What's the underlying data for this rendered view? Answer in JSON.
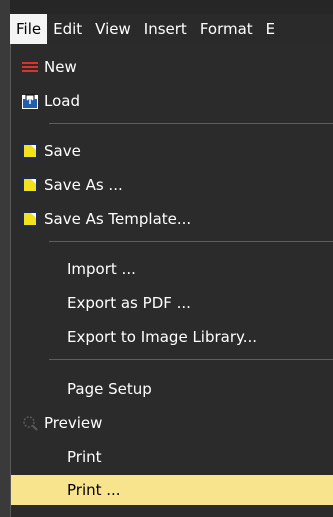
{
  "menubar": {
    "items": [
      {
        "label": "File",
        "active": true
      },
      {
        "label": "Edit"
      },
      {
        "label": "View"
      },
      {
        "label": "Insert"
      },
      {
        "label": "Format"
      },
      {
        "label": "E"
      }
    ]
  },
  "file_menu": {
    "new": "New",
    "load": "Load",
    "save": "Save",
    "save_as": "Save As ...",
    "save_as_template": "Save As Template...",
    "import": "Import ...",
    "export_pdf": "Export as PDF ...",
    "export_image_library": "Export to Image Library...",
    "page_setup": "Page Setup",
    "preview": "Preview",
    "print": "Print",
    "print_dialog": "Print ..."
  },
  "colors": {
    "highlight": "#f7e48c",
    "new_icon": "#d9342b",
    "save_icon": "#f2e21d"
  },
  "icons": {
    "new": "hamburger-icon",
    "load": "folder-open-icon",
    "save": "floppy-icon",
    "preview": "magnifier-icon"
  }
}
